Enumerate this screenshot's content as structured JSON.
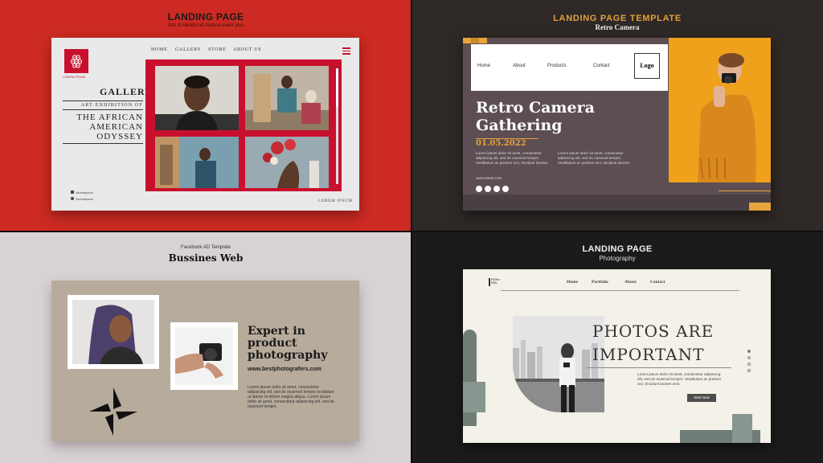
{
  "q1": {
    "title": "LANDING PAGE",
    "subtitle": "Arts & Handicraft festival event plus",
    "logo_glyph": "ꙮ",
    "logo_text": "LOREM IPSUM",
    "nav": [
      "HOME",
      "GALLERY",
      "STORE",
      "ABOUT US"
    ],
    "gallery_heading": "GALLERY",
    "exhibition_label": "ART EXHIBITION OF",
    "headline_lines": [
      "THE AFRICAN",
      "AMERICAN",
      "ODYSSEY"
    ],
    "social": [
      "/loremipsum",
      "/loremipsum"
    ],
    "footer": "LOREM IPSUM",
    "accent": "#c8102e"
  },
  "q2": {
    "title": "LANDING  PAGE TEMPLATE",
    "subtitle": "Retro Camera",
    "nav": [
      "Home",
      "About",
      "Products",
      "Contact"
    ],
    "logo": "Logo",
    "headline_lines": [
      "Retro Camera",
      "Gathering"
    ],
    "date": "01.05.2022",
    "para1": "Lorem ipsum dolor sit amet, consectetur adipiscing elit, sed do eiusmod tempor. Vestibulum ac pretium orci, tincidunt laoreet.",
    "para2": "Lorem ipsum dolor sit amet, consectetur adipiscing elit, sed do eiusmod tempor. Vestibulum ac pretium orci, tincidunt laoreet.",
    "website": "www.reteal.com",
    "accent": "#e8a23c"
  },
  "q3": {
    "title": "Facebook AD Template",
    "subtitle": "Bussines Web",
    "headline_lines": [
      "Expert in",
      "product",
      "photography"
    ],
    "url": "www.bestphotografers.com",
    "para": "Lorem ipsum dolor sit amet, consectetur adipiscing elit, sed do eiusmod tempor incididunt ut labore et dolore magna aliqua. Lorem ipsum dolor sit amet, consectetur adipiscing elit, sed do eiusmod tempor.",
    "accent": "#b7ab9c"
  },
  "q4": {
    "title": "LANDING PAGE",
    "subtitle": "Photography",
    "logo_lines": [
      "Hellen",
      "Hills"
    ],
    "nav": [
      "Home",
      "Portfolio",
      "About",
      "Contact"
    ],
    "headline_lines": [
      "PHOTOS ARE",
      "IMPORTANT"
    ],
    "para": "Lorem ipsum dolor sit amet, consectetur adipiscing elit, sed do eiusmod tempor. Vestibulum ac pretium orci, tincidunt laoreet eros.",
    "button": "Start Now",
    "accent": "#6f7d76"
  }
}
